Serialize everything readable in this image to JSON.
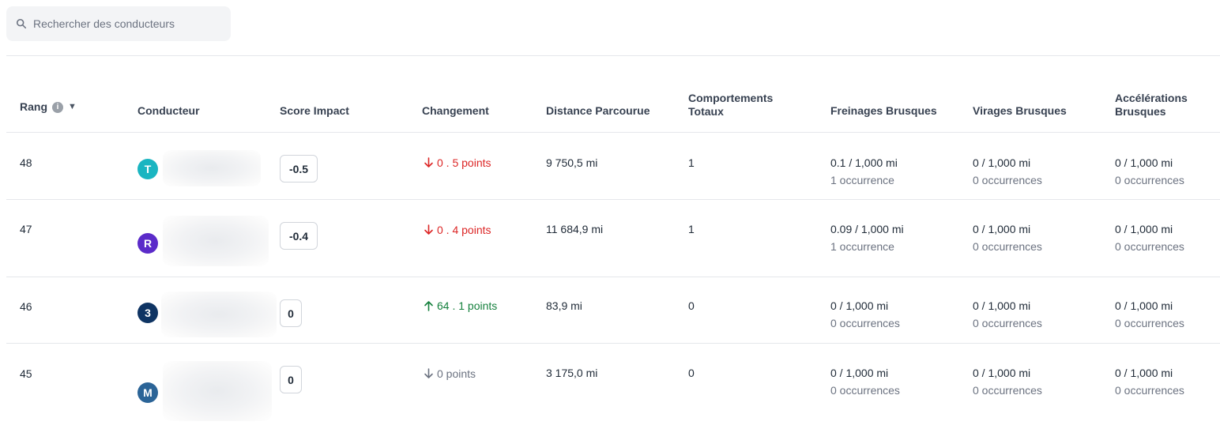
{
  "search": {
    "placeholder": "Rechercher des conducteurs"
  },
  "columns": {
    "rang": "Rang",
    "conducteur": "Conducteur",
    "score_impact": "Score Impact",
    "changement": "Changement",
    "distance": "Distance Parcourue",
    "comportements_l1": "Comportements",
    "comportements_l2": "Totaux",
    "freinages": "Freinages Brusques",
    "virages": "Virages Brusques",
    "accelerations_l1": "Accélérations",
    "accelerations_l2": "Brusques"
  },
  "rows": [
    {
      "rang": "48",
      "avatar": "T",
      "avatar_color": "#1ab5c1",
      "score": "-0.5",
      "change_dir": "down",
      "change": "0 . 5 points",
      "distance": "9 750,5 mi",
      "comportements": "1",
      "freinages": "0.1 / 1,000 mi",
      "freinages_occ": "1 occurrence",
      "virages": "0 / 1,000 mi",
      "virages_occ": "0 occurrences",
      "accelerations": "0 / 1,000 mi",
      "accelerations_occ": "0 occurrences"
    },
    {
      "rang": "47",
      "avatar": "R",
      "avatar_color": "#5b2bc9",
      "score": "-0.4",
      "change_dir": "down",
      "change": "0 . 4 points",
      "distance": "11 684,9 mi",
      "comportements": "1",
      "freinages": "0.09 / 1,000 mi",
      "freinages_occ": "1 occurrence",
      "virages": "0 / 1,000 mi",
      "virages_occ": "0 occurrences",
      "accelerations": "0 / 1,000 mi",
      "accelerations_occ": "0 occurrences"
    },
    {
      "rang": "46",
      "avatar": "3",
      "avatar_color": "#0f3463",
      "score": "0",
      "change_dir": "up",
      "change": "64 . 1 points",
      "distance": "83,9 mi",
      "comportements": "0",
      "freinages": "0 / 1,000 mi",
      "freinages_occ": "0 occurrences",
      "virages": "0 / 1,000 mi",
      "virages_occ": "0 occurrences",
      "accelerations": "0 / 1,000 mi",
      "accelerations_occ": "0 occurrences"
    },
    {
      "rang": "45",
      "avatar": "M",
      "avatar_color": "#2b6497",
      "score": "0",
      "change_dir": "neutral",
      "change": "0 points",
      "distance": "3 175,0 mi",
      "comportements": "0",
      "freinages": "0 / 1,000 mi",
      "freinages_occ": "0 occurrences",
      "virages": "0 / 1,000 mi",
      "virages_occ": "0 occurrences",
      "accelerations": "0 / 1,000 mi",
      "accelerations_occ": "0 occurrences"
    }
  ]
}
